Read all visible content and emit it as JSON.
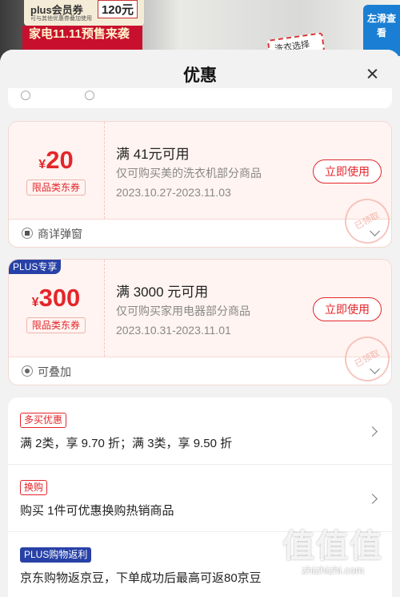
{
  "background": {
    "card_title": "plus会员券",
    "card_note": "可与其他优惠券叠加使用",
    "card_price": "120元",
    "banner": "家电11.11预售来袭",
    "tag": "洗衣选择",
    "side": "左滑查看"
  },
  "sheet": {
    "title": "优惠"
  },
  "coupons": [
    {
      "currency": "¥",
      "amount": "20",
      "type": "限品类东券",
      "condition": "满 41元可用",
      "description": "仅可购买美的洗衣机部分商品",
      "date_range": "2023.10.27-2023.11.03",
      "button": "立即使用",
      "stamp": "已领取",
      "footer": "商详弹窗"
    },
    {
      "badge": "PLUS专享",
      "currency": "¥",
      "amount": "300",
      "type": "限品类东券",
      "condition": "满 3000 元可用",
      "description": "仅可购买家用电器部分商品",
      "date_range": "2023.10.31-2023.11.01",
      "button": "立即使用",
      "stamp": "已领取",
      "footer": "可叠加"
    }
  ],
  "promotions": [
    {
      "tag": "多买优惠",
      "text": "满 2类，享 9.70 折；满 3类，享 9.50 折"
    },
    {
      "tag": "换购",
      "text": "购买 1件可优惠换购热销商品"
    },
    {
      "tag": "PLUS购物返利",
      "text": "京东购物返京豆，下单成功后最高可返80京豆"
    }
  ],
  "watermark": {
    "logo": "值值值",
    "url": "zhizhizhi.com"
  },
  "colors": {
    "accent": "#e4262b",
    "plus": "#2741a6"
  }
}
